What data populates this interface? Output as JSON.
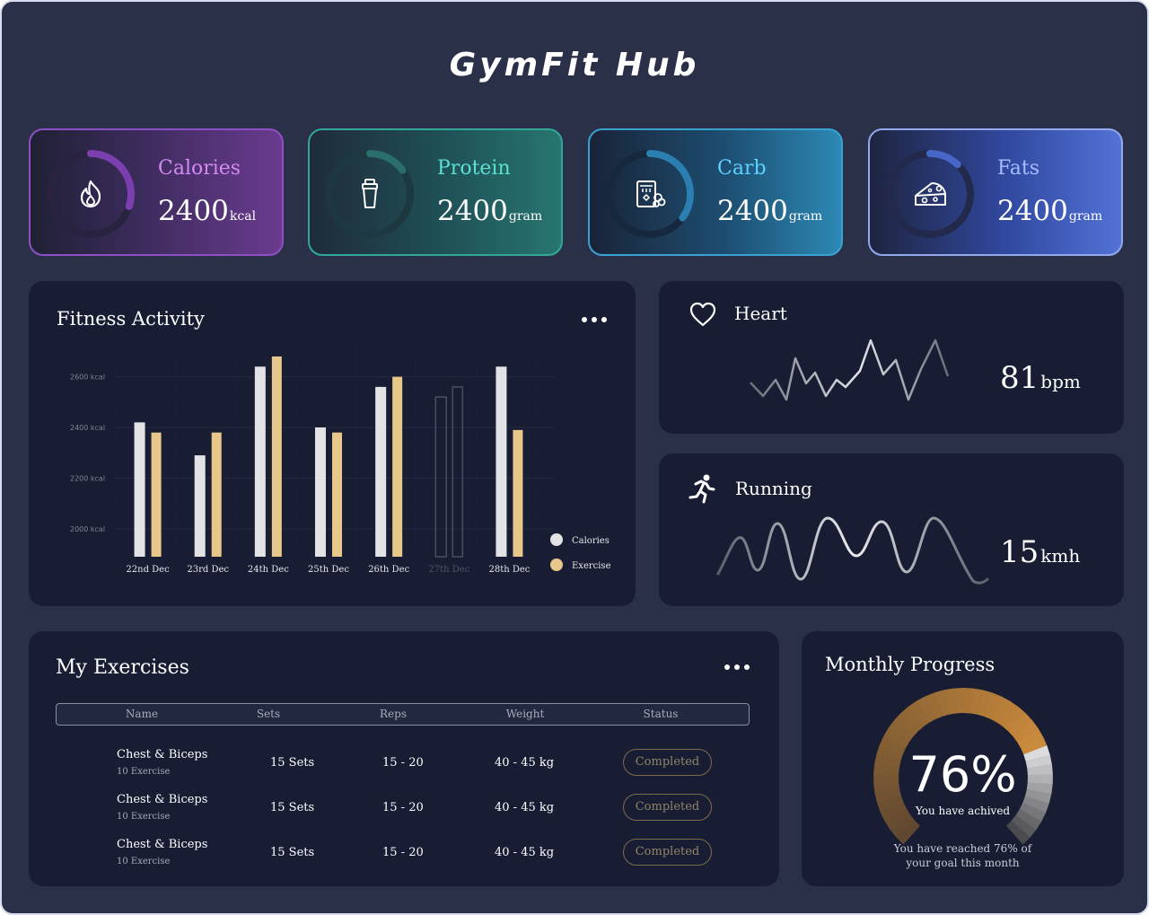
{
  "app": {
    "title": "GymFit Hub"
  },
  "stats": [
    {
      "label": "Calories",
      "value": "2400",
      "unit": "kcal",
      "icon": "calories-flame-icon",
      "ring_fraction": 0.3,
      "color": "#d38af2"
    },
    {
      "label": "Protein",
      "value": "2400",
      "unit": "gram",
      "icon": "protein-shaker-icon",
      "ring_fraction": 0.15,
      "color": "#5de0d4"
    },
    {
      "label": "Carb",
      "value": "2400",
      "unit": "gram",
      "icon": "carb-food-icon",
      "ring_fraction": 0.35,
      "color": "#5fd0ff"
    },
    {
      "label": "Fats",
      "value": "2400",
      "unit": "gram",
      "icon": "fats-cheese-icon",
      "ring_fraction": 0.12,
      "color": "#a9bcff"
    }
  ],
  "fitness": {
    "title": "Fitness Activity",
    "chart_data": {
      "type": "bar",
      "categories": [
        "22nd Dec",
        "23rd Dec",
        "24th Dec",
        "25th Dec",
        "26th Dec",
        "27th Dec",
        "28th Dec"
      ],
      "ytick_labels": [
        "2600 kcal",
        "2400 kcal",
        "2200 kcal",
        "2000 kcal"
      ],
      "yticks": [
        2600,
        2400,
        2200,
        2000
      ],
      "ylim": [
        1890,
        2680
      ],
      "series": [
        {
          "name": "Calories",
          "values": [
            2420,
            2290,
            2640,
            2400,
            2560,
            2520,
            2640
          ],
          "color": "#e3e3e6"
        },
        {
          "name": "Exercise",
          "values": [
            2380,
            2380,
            2680,
            2380,
            2600,
            2560,
            2390
          ],
          "color": "#e8c88a"
        }
      ],
      "dimmed_categories": [
        "27th Dec"
      ],
      "legend": "bottom-right",
      "grid": true
    }
  },
  "heart": {
    "label": "Heart",
    "value": "81",
    "unit": "bpm"
  },
  "running": {
    "label": "Running",
    "value": "15",
    "unit": "kmh"
  },
  "exercises": {
    "title": "My Exercises",
    "columns": [
      "Name",
      "Sets",
      "Reps",
      "Weight",
      "Status"
    ],
    "rows": [
      {
        "name": "Chest & Biceps",
        "sub": "10 Exercise",
        "sets": "15 Sets",
        "reps": "15 - 20",
        "weight": "40 - 45 kg",
        "status": "Completed"
      },
      {
        "name": "Chest & Biceps",
        "sub": "10 Exercise",
        "sets": "15 Sets",
        "reps": "15 - 20",
        "weight": "40 - 45 kg",
        "status": "Completed"
      },
      {
        "name": "Chest & Biceps",
        "sub": "10 Exercise",
        "sets": "15 Sets",
        "reps": "15 - 20",
        "weight": "40 - 45 kg",
        "status": "Completed"
      }
    ]
  },
  "progress": {
    "title": "Monthly Progress",
    "percent": "76%",
    "percent_value": 0.76,
    "sub": "You have achived",
    "note_line1": "You have reached 76% of",
    "note_line2": "your goal this month"
  }
}
